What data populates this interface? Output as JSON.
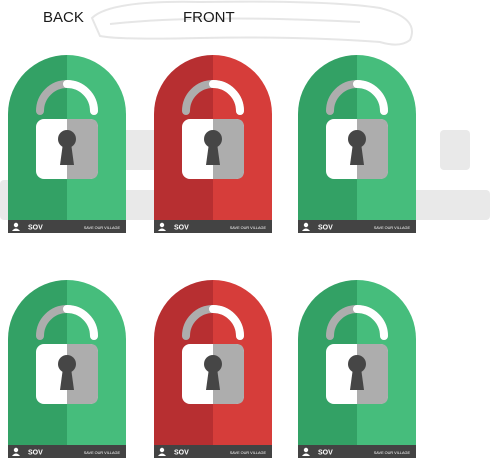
{
  "labels": {
    "back": "BACK",
    "front": "FRONT"
  },
  "colors": {
    "green_dark": "#33a165",
    "green_light": "#46bd7c",
    "red_dark": "#b72f31",
    "red_light": "#d63d3a",
    "footer": "#434343",
    "lock_white": "#ffffff",
    "lock_gray": "#adadad",
    "keyhole": "#464646"
  },
  "footer": {
    "brand": "SOV",
    "tagline": "SAVE OUR VILLAGE"
  },
  "cards": [
    {
      "variant": "green",
      "icon": "padlock-icon"
    },
    {
      "variant": "red",
      "icon": "padlock-icon"
    },
    {
      "variant": "green",
      "icon": "padlock-icon"
    },
    {
      "variant": "green",
      "icon": "padlock-icon"
    },
    {
      "variant": "red",
      "icon": "padlock-icon"
    },
    {
      "variant": "green",
      "icon": "padlock-icon"
    }
  ]
}
